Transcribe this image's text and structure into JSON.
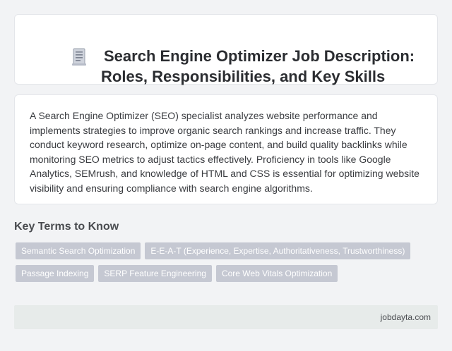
{
  "header": {
    "icon": "document-icon",
    "title_line1": "Search Engine Optimizer Job Description:",
    "title_line2": "Roles, Responsibilities, and Key Skills"
  },
  "description": "A Search Engine Optimizer (SEO) specialist analyzes website performance and implements strategies to improve organic search rankings and increase traffic. They conduct keyword research, optimize on-page content, and build quality backlinks while monitoring SEO metrics to adjust tactics effectively. Proficiency in tools like Google Analytics, SEMrush, and knowledge of HTML and CSS is essential for optimizing website visibility and ensuring compliance with search engine algorithms.",
  "key_terms": {
    "heading": "Key Terms to Know",
    "tags": [
      "Semantic Search Optimization",
      "E-E-A-T (Experience, Expertise, Authoritativeness, Trustworthiness)",
      "Passage Indexing",
      "SERP Feature Engineering",
      "Core Web Vitals Optimization"
    ]
  },
  "footer": {
    "source": "jobdayta.com"
  },
  "colors": {
    "background": "#f2f3f5",
    "card": "#ffffff",
    "tag": "#c5c8d2",
    "footer": "#e7ebea"
  }
}
